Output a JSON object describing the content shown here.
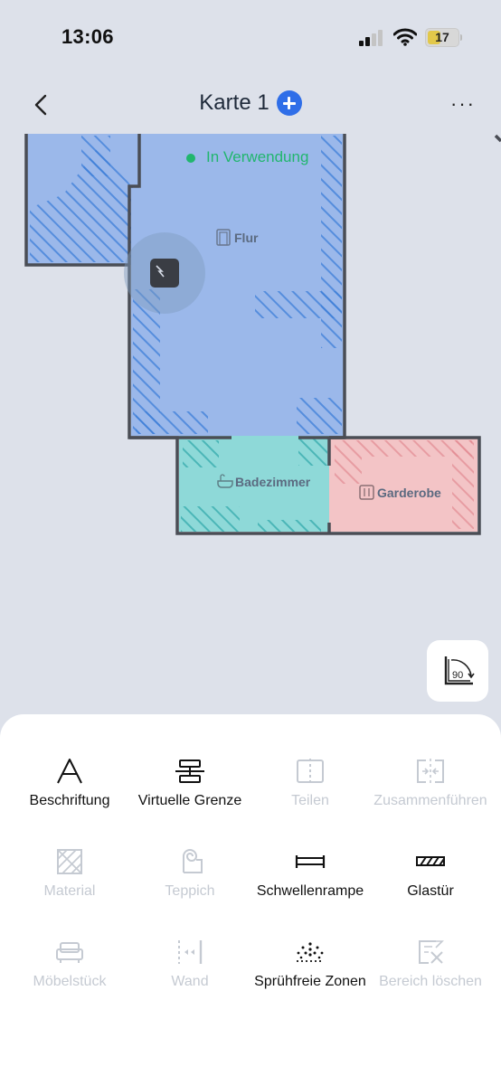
{
  "status_bar": {
    "time": "13:06",
    "battery": "17"
  },
  "nav": {
    "title": "Karte 1",
    "back_icon": "chevron-left-icon",
    "add_icon": "plus-circle-icon",
    "more": "···"
  },
  "map": {
    "status": "In Verwendung",
    "rooms": {
      "flur": "Flur",
      "bad": "Badezimmer",
      "garderobe": "Garderobe"
    },
    "colors": {
      "flur": "#9bb8ea",
      "bad": "#8ed9d8",
      "garderobe": "#f3c4c6",
      "hatch": "#3d7fd9",
      "wall": "#4a4d55",
      "status": "#21b66e"
    },
    "rotate_label": "90"
  },
  "tools": [
    {
      "label": "Beschriftung",
      "enabled": true,
      "icon": "text-label-icon"
    },
    {
      "label": "Virtuelle Grenze",
      "enabled": true,
      "icon": "virtual-boundary-icon"
    },
    {
      "label": "Teilen",
      "enabled": false,
      "icon": "split-icon"
    },
    {
      "label": "Zusammenführen",
      "enabled": false,
      "icon": "merge-icon"
    },
    {
      "label": "Material",
      "enabled": false,
      "icon": "material-icon"
    },
    {
      "label": "Teppich",
      "enabled": false,
      "icon": "carpet-icon"
    },
    {
      "label": "Schwellenrampe",
      "enabled": true,
      "icon": "threshold-ramp-icon"
    },
    {
      "label": "Glastür",
      "enabled": true,
      "icon": "glass-door-icon"
    },
    {
      "label": "Möbelstück",
      "enabled": false,
      "icon": "furniture-icon"
    },
    {
      "label": "Wand",
      "enabled": false,
      "icon": "wall-icon"
    },
    {
      "label": "Sprühfreie Zonen",
      "enabled": true,
      "icon": "no-spray-zone-icon"
    },
    {
      "label": "Bereich löschen",
      "enabled": false,
      "icon": "erase-area-icon"
    }
  ]
}
